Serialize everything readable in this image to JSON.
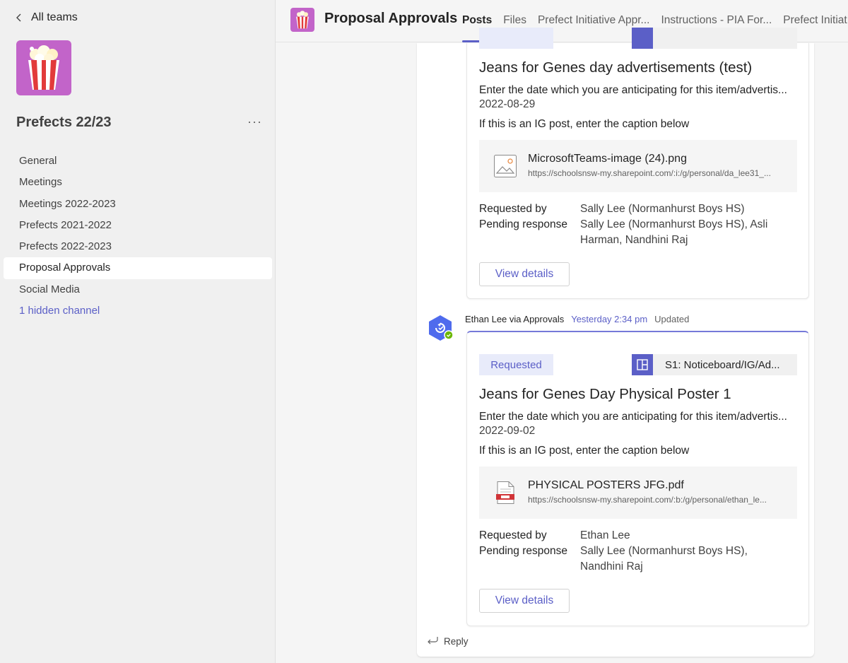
{
  "sidebar": {
    "back_label": "All teams",
    "team_name": "Prefects 22/23",
    "more_label": "···",
    "channels": [
      {
        "label": "General"
      },
      {
        "label": "Meetings"
      },
      {
        "label": "Meetings 2022-2023"
      },
      {
        "label": "Prefects 2021-2022"
      },
      {
        "label": "Prefects 2022-2023"
      },
      {
        "label": "Proposal Approvals"
      },
      {
        "label": "Social Media"
      }
    ],
    "hidden_channels_label": "1 hidden channel"
  },
  "header": {
    "title": "Proposal Approvals",
    "tabs": [
      {
        "label": "Posts"
      },
      {
        "label": "Files"
      },
      {
        "label": "Prefect Initiative Appr..."
      },
      {
        "label": "Instructions - PIA For..."
      },
      {
        "label": "Prefect Initiat"
      }
    ]
  },
  "posts": [
    {
      "title": "Jeans for Genes day advertisements (test)",
      "question1": "Enter the date which you are anticipating for this item/advertis...",
      "date": "2022-08-29",
      "question2": "If this is an IG post, enter the caption below",
      "attachment": {
        "name": "MicrosoftTeams-image (24).png",
        "url": "https://schoolsnsw-my.sharepoint.com/:i:/g/personal/da_lee31_...",
        "icon": "image-file-icon"
      },
      "requested_by_label": "Requested by",
      "requested_by": "Sally Lee (Normanhurst Boys HS)",
      "pending_label": "Pending response",
      "pending": "Sally Lee (Normanhurst Boys HS), Asli Harman, Nandhini Raj",
      "button": "View details"
    },
    {
      "author": "Ethan Lee via Approvals",
      "time": "Yesterday 2:34 pm",
      "updated": "Updated",
      "status": "Requested",
      "flow": "S1: Noticeboard/IG/Ad...",
      "title": "Jeans for Genes Day Physical Poster 1",
      "question1": "Enter the date which you are anticipating for this item/advertis...",
      "date": "2022-09-02",
      "question2": "If this is an IG post, enter the caption below",
      "attachment": {
        "name": "PHYSICAL POSTERS JFG.pdf",
        "url": "https://schoolsnsw-my.sharepoint.com/:b:/g/personal/ethan_le...",
        "icon": "pdf-file-icon"
      },
      "requested_by_label": "Requested by",
      "requested_by": "Ethan Lee",
      "pending_label": "Pending response",
      "pending": "Sally Lee (Normanhurst Boys HS), Nandhini Raj",
      "button": "View details"
    }
  ],
  "reply_label": "Reply",
  "colors": {
    "accent": "#5b5fc7",
    "team_logo_bg": "#c264c9",
    "badge_bg": "#e8ebfa"
  }
}
